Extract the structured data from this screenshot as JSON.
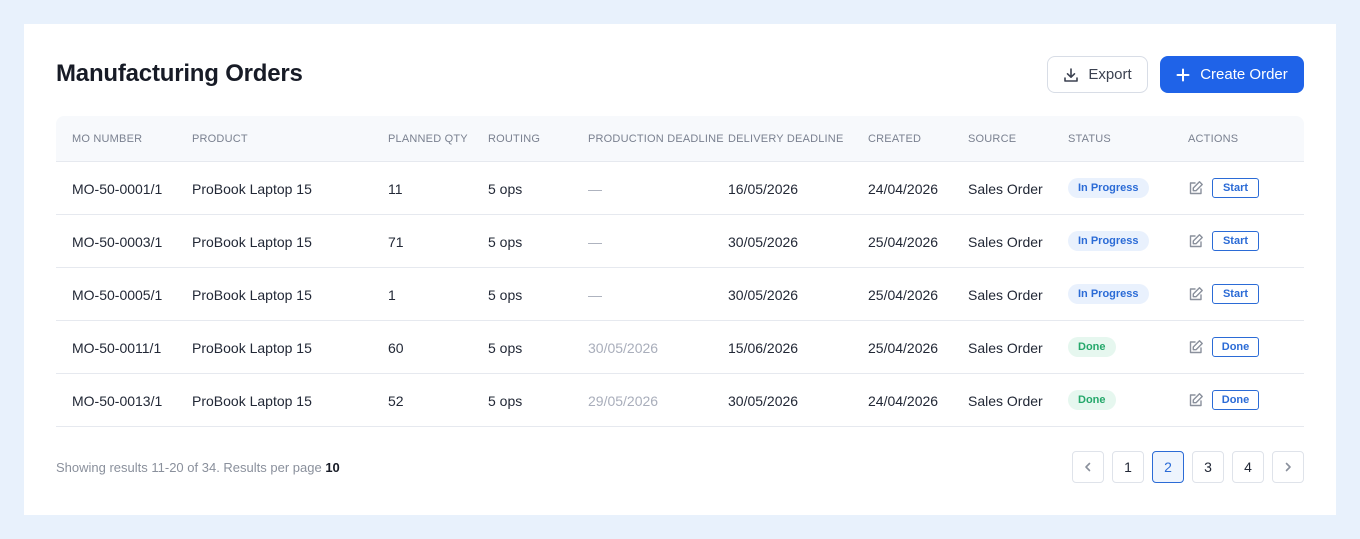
{
  "header": {
    "title": "Manufacturing Orders",
    "export_label": "Export",
    "create_label": "Create Order"
  },
  "table": {
    "columns": [
      "MO NUMBER",
      "PRODUCT",
      "PLANNED QTY",
      "ROUTING",
      "PRODUCTION DEADLINE",
      "DELIVERY DEADLINE",
      "CREATED",
      "SOURCE",
      "STATUS",
      "ACTIONS"
    ],
    "rows": [
      {
        "mo": "MO-50-0001/1",
        "product": "ProBook Laptop 15",
        "qty": "11",
        "routing": "5 ops",
        "prod_deadline": "—",
        "delivery": "16/05/2026",
        "created": "24/04/2026",
        "source": "Sales Order",
        "status": "In Progress",
        "action": "Start"
      },
      {
        "mo": "MO-50-0003/1",
        "product": "ProBook Laptop 15",
        "qty": "71",
        "routing": "5 ops",
        "prod_deadline": "—",
        "delivery": "30/05/2026",
        "created": "25/04/2026",
        "source": "Sales Order",
        "status": "In Progress",
        "action": "Start"
      },
      {
        "mo": "MO-50-0005/1",
        "product": "ProBook Laptop 15",
        "qty": "1",
        "routing": "5 ops",
        "prod_deadline": "—",
        "delivery": "30/05/2026",
        "created": "25/04/2026",
        "source": "Sales Order",
        "status": "In Progress",
        "action": "Start"
      },
      {
        "mo": "MO-50-0011/1",
        "product": "ProBook Laptop 15",
        "qty": "60",
        "routing": "5 ops",
        "prod_deadline": "30/05/2026",
        "delivery": "15/06/2026",
        "created": "25/04/2026",
        "source": "Sales Order",
        "status": "Done",
        "action": "Done"
      },
      {
        "mo": "MO-50-0013/1",
        "product": "ProBook Laptop 15",
        "qty": "52",
        "routing": "5 ops",
        "prod_deadline": "29/05/2026",
        "delivery": "30/05/2026",
        "created": "24/04/2026",
        "source": "Sales Order",
        "status": "Done",
        "action": "Done"
      }
    ]
  },
  "footer": {
    "showing_text": "Showing results 11-20 of 34. Results per page",
    "per_page": "10"
  },
  "pagination": {
    "pages": [
      "1",
      "2",
      "3",
      "4"
    ],
    "current": "2"
  },
  "colors": {
    "accent": "#1f63e8",
    "in_progress": "#2b6bd6",
    "done": "#25a86b",
    "background": "#e8f1fc"
  },
  "icons": {
    "export": "download-icon",
    "create": "plus-icon",
    "edit": "edit-icon",
    "prev": "chevron-left-icon",
    "next": "chevron-right-icon"
  }
}
